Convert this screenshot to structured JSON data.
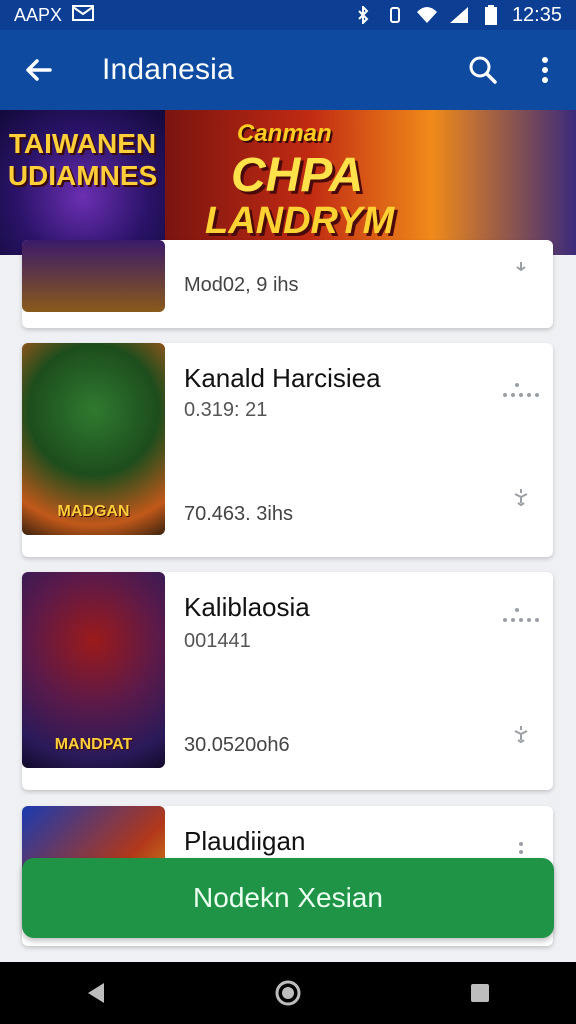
{
  "status": {
    "left_text": "AAPX",
    "time": "12:35"
  },
  "appbar": {
    "title": "Indanesia"
  },
  "banner": {
    "left_text": "TAIWANEN UDIAMNES",
    "title_top": "Canman",
    "title_mid": "CHPA",
    "title_bottom": "LANDRYM"
  },
  "items": [
    {
      "title": "",
      "sub": "",
      "stat": "Mod02, 9 ihs"
    },
    {
      "title": "Kanald Harcisiea",
      "sub": "0.319: 21",
      "stat": "70.463. 3ihs",
      "thumb_label": "MADGAN"
    },
    {
      "title": "Kaliblaosia",
      "sub": "001441",
      "stat": "30.0520oh6",
      "thumb_label": "MANDPAT"
    },
    {
      "title": "Plaudiigan",
      "sub": "",
      "stat": ""
    }
  ],
  "primary_button": {
    "label": "Nodekn Xesian"
  },
  "colors": {
    "status_bar": "#0c3f93",
    "app_bar": "#0d4aa0",
    "primary": "#1f9447",
    "nav_bar": "#000000"
  },
  "icons": {
    "back": "arrow-left-icon",
    "search": "search-icon",
    "overflow": "more-vert-icon",
    "wifi": "wifi-icon",
    "signal": "signal-icon",
    "battery": "battery-icon",
    "bluetooth": "bluetooth-icon",
    "mail": "mail-icon"
  }
}
